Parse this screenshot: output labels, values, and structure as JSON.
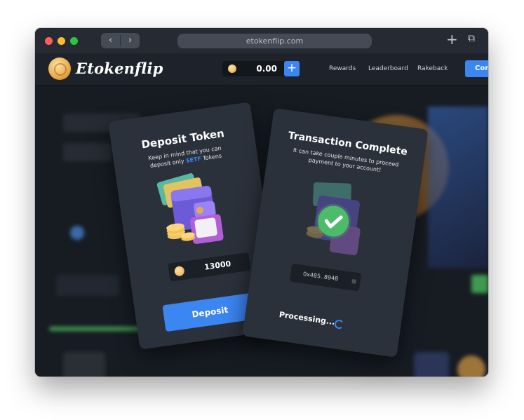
{
  "browser": {
    "url": "etokenflip.com",
    "back_icon": "‹",
    "forward_icon": "›",
    "new_tab_icon": "+",
    "tabs_icon": "⧉"
  },
  "site": {
    "brand": "Etokenflip",
    "balance": "0.00",
    "add_funds": "+",
    "nav": [
      "Rewards",
      "Leaderboard",
      "Rakeback"
    ],
    "connect_label": "Con"
  },
  "deposit_card": {
    "title": "Deposit Token",
    "subtitle_1": "Keep in mind that you can",
    "subtitle_2_pre": "deposit only ",
    "subtitle_2_token": "$ETF",
    "subtitle_2_post": " Tokens",
    "amount": "13000",
    "button_label": "Deposit"
  },
  "transaction_card": {
    "title": "Transaction Complete",
    "subtitle_1": "It can take couple minutes to proceed",
    "subtitle_2": "payment to your account!",
    "tx_hash": "0x485..8948",
    "status": "Processing..."
  },
  "colors": {
    "accent": "#3b86f0",
    "success": "#4cbb6a",
    "coin": "#e8a94a"
  }
}
